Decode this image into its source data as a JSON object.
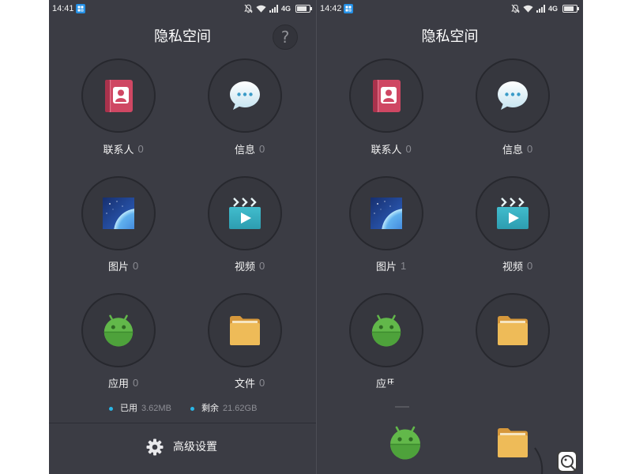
{
  "colors": {
    "screen_background": "#3b3c44",
    "accent": "#29b6e6",
    "count_text": "#8a8b92"
  },
  "screens": [
    {
      "status": {
        "time": "14:41",
        "network": "4G"
      },
      "title": "隐私空间",
      "help": "?",
      "items": [
        {
          "label": "联系人",
          "count": "0",
          "icon": "contacts-icon"
        },
        {
          "label": "信息",
          "count": "0",
          "icon": "messages-icon"
        },
        {
          "label": "图片",
          "count": "0",
          "icon": "pictures-icon"
        },
        {
          "label": "视频",
          "count": "0",
          "icon": "videos-icon"
        },
        {
          "label": "应用",
          "count": "0",
          "icon": "apps-icon"
        },
        {
          "label": "文件",
          "count": "0",
          "icon": "files-icon"
        }
      ],
      "storage": {
        "used_label": "已用",
        "used_value": "3.62MB",
        "free_label": "剩余",
        "free_value": "21.62GB"
      },
      "settings_label": "高级设置"
    },
    {
      "status": {
        "time": "14:42",
        "network": "4G"
      },
      "title": "隐私空间",
      "items": [
        {
          "label": "联系人",
          "count": "0",
          "icon": "contacts-icon"
        },
        {
          "label": "信息",
          "count": "0",
          "icon": "messages-icon"
        },
        {
          "label": "图片",
          "count": "1",
          "icon": "pictures-icon"
        },
        {
          "label": "视频",
          "count": "0",
          "icon": "videos-icon"
        },
        {
          "label": "应用",
          "icon": "apps-icon"
        },
        {
          "icon": "files-icon"
        }
      ],
      "dragging": [
        {
          "icon": "apps-icon"
        },
        {
          "icon": "files-icon"
        }
      ]
    }
  ]
}
